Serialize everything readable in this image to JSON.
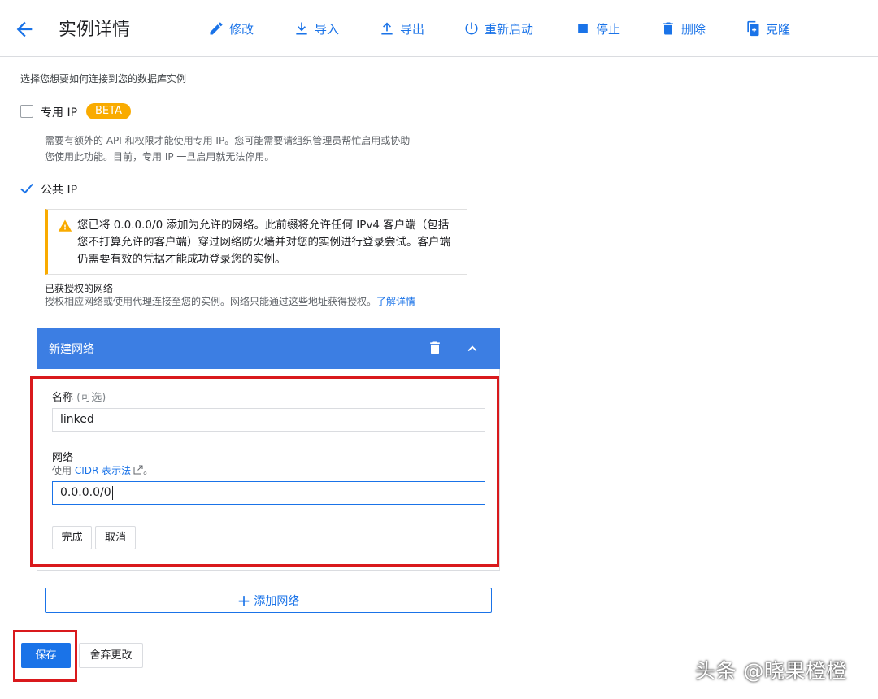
{
  "header": {
    "title": "实例详情",
    "actions": {
      "edit": "修改",
      "import": "导入",
      "export": "导出",
      "restart": "重新启动",
      "stop": "停止",
      "delete": "删除",
      "clone": "克隆"
    }
  },
  "connectivity": {
    "intro": "选择您想要如何连接到您的数据库实例",
    "private_ip": {
      "label": "专用 IP",
      "badge": "BETA",
      "checked": false,
      "help_line1": "需要有额外的 API 和权限才能使用专用 IP。您可能需要请组织管理员帮忙启用或协助",
      "help_line2": "您使用此功能。目前，专用 IP 一旦启用就无法停用。"
    },
    "public_ip": {
      "label": "公共 IP",
      "checked": true
    },
    "warning": "您已将 0.0.0.0/0 添加为允许的网络。此前缀将允许任何 IPv4 客户端（包括您不打算允许的客户端）穿过网络防火墙并对您的实例进行登录尝试。客户端仍需要有效的凭据才能成功登录您的实例。",
    "authorized": {
      "title": "已获授权的网络",
      "description": "授权相应网络或使用代理连接至您的实例。网络只能通过这些地址获得授权。",
      "learn_more": "了解详情"
    }
  },
  "network_panel": {
    "title": "新建网络",
    "name_label": "名称",
    "name_optional": "(可选)",
    "name_value": "linked",
    "network_label": "网络",
    "network_hint_prefix": "使用",
    "network_hint_link": "CIDR 表示法",
    "network_hint_suffix": "。",
    "network_value": "0.0.0.0/0",
    "done": "完成",
    "cancel": "取消"
  },
  "add_network": "添加网络",
  "footer": {
    "save": "保存",
    "discard": "舍弃更改"
  },
  "watermark": "头条 @晓果橙橙",
  "colors": {
    "accent": "#1a73e8",
    "panel_header": "#3c7ee3",
    "warning": "#f9ab00",
    "highlight_box": "#d9191c"
  }
}
